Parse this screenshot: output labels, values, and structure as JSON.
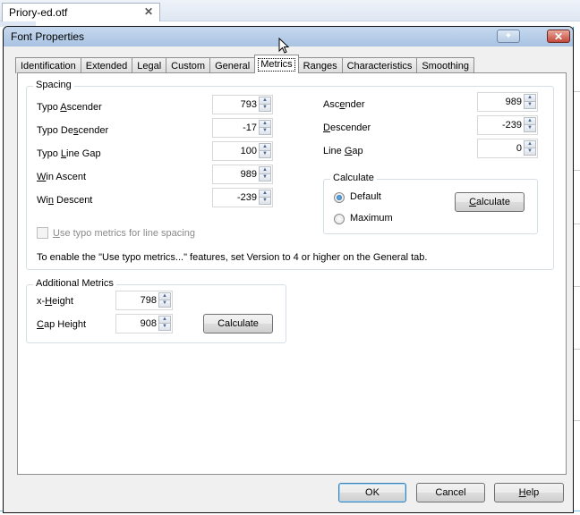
{
  "document_tab": {
    "title": "Priory-ed.otf",
    "close_glyph": "✕"
  },
  "dialog": {
    "title": "Font Properties",
    "pin_glyph": "📌",
    "close_glyph": "✕",
    "tabs": [
      {
        "label": "Identification",
        "active": false
      },
      {
        "label": "Extended",
        "active": false
      },
      {
        "label": "Legal",
        "active": false
      },
      {
        "label": "Custom",
        "active": false
      },
      {
        "label": "General",
        "active": false
      },
      {
        "label": "Metrics",
        "active": true
      },
      {
        "label": "Ranges",
        "active": false
      },
      {
        "label": "Characteristics",
        "active": false
      },
      {
        "label": "Smoothing",
        "active": false
      }
    ],
    "spacing": {
      "title": "Spacing",
      "typo_ascender": {
        "label_pre": "Typo ",
        "label_u": "A",
        "label_post": "scender",
        "value": "793"
      },
      "typo_descender": {
        "label_pre": "Typo De",
        "label_u": "s",
        "label_post": "cender",
        "value": "-17"
      },
      "typo_line_gap": {
        "label_pre": "Typo ",
        "label_u": "L",
        "label_post": "ine Gap",
        "value": "100"
      },
      "win_ascent": {
        "label_pre": "",
        "label_u": "W",
        "label_post": "in Ascent",
        "value": "989"
      },
      "win_descent": {
        "label_pre": "Wi",
        "label_u": "n",
        "label_post": " Descent",
        "value": "-239"
      },
      "ascender": {
        "label_pre": "Asc",
        "label_u": "e",
        "label_post": "nder",
        "value": "989"
      },
      "descender": {
        "label_pre": "",
        "label_u": "D",
        "label_post": "escender",
        "value": "-239"
      },
      "line_gap": {
        "label_pre": "Line ",
        "label_u": "G",
        "label_post": "ap",
        "value": "0"
      },
      "calculate_group": {
        "title": "Calculate",
        "options": [
          {
            "label": "Default",
            "checked": true
          },
          {
            "label": "Maximum",
            "checked": false
          }
        ],
        "button_u": "C",
        "button_rest": "alculate"
      },
      "use_typo_checkbox": {
        "label_u": "U",
        "label_rest": "se typo metrics for line spacing",
        "checked": false,
        "enabled": false
      },
      "note": "To enable the \"Use typo metrics...\" features, set Version to 4 or higher on the General tab."
    },
    "additional_metrics": {
      "title": "Additional Metrics",
      "x_height": {
        "label_pre": "x-",
        "label_u": "H",
        "label_post": "eight",
        "value": "798"
      },
      "cap_height": {
        "label_pre": "",
        "label_u": "C",
        "label_post": "ap Height",
        "value": "908"
      },
      "calculate_button": "Calculate"
    },
    "buttons": {
      "ok": "OK",
      "cancel": "Cancel",
      "help_u": "H",
      "help_rest": "elp"
    }
  }
}
